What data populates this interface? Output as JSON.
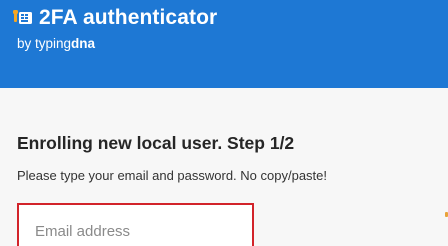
{
  "header": {
    "title": "2FA authenticator",
    "icon": "keypad-icon",
    "byline_prefix": "by typing",
    "byline_brand": "dna",
    "background_color": "#1e78d4"
  },
  "main": {
    "heading": "Enrolling new local user. Step 1/2",
    "instructions": "Please type your email and password. No copy/paste!",
    "email_field": {
      "placeholder": "Email address",
      "value": "",
      "border_color": "#d2232a"
    }
  }
}
